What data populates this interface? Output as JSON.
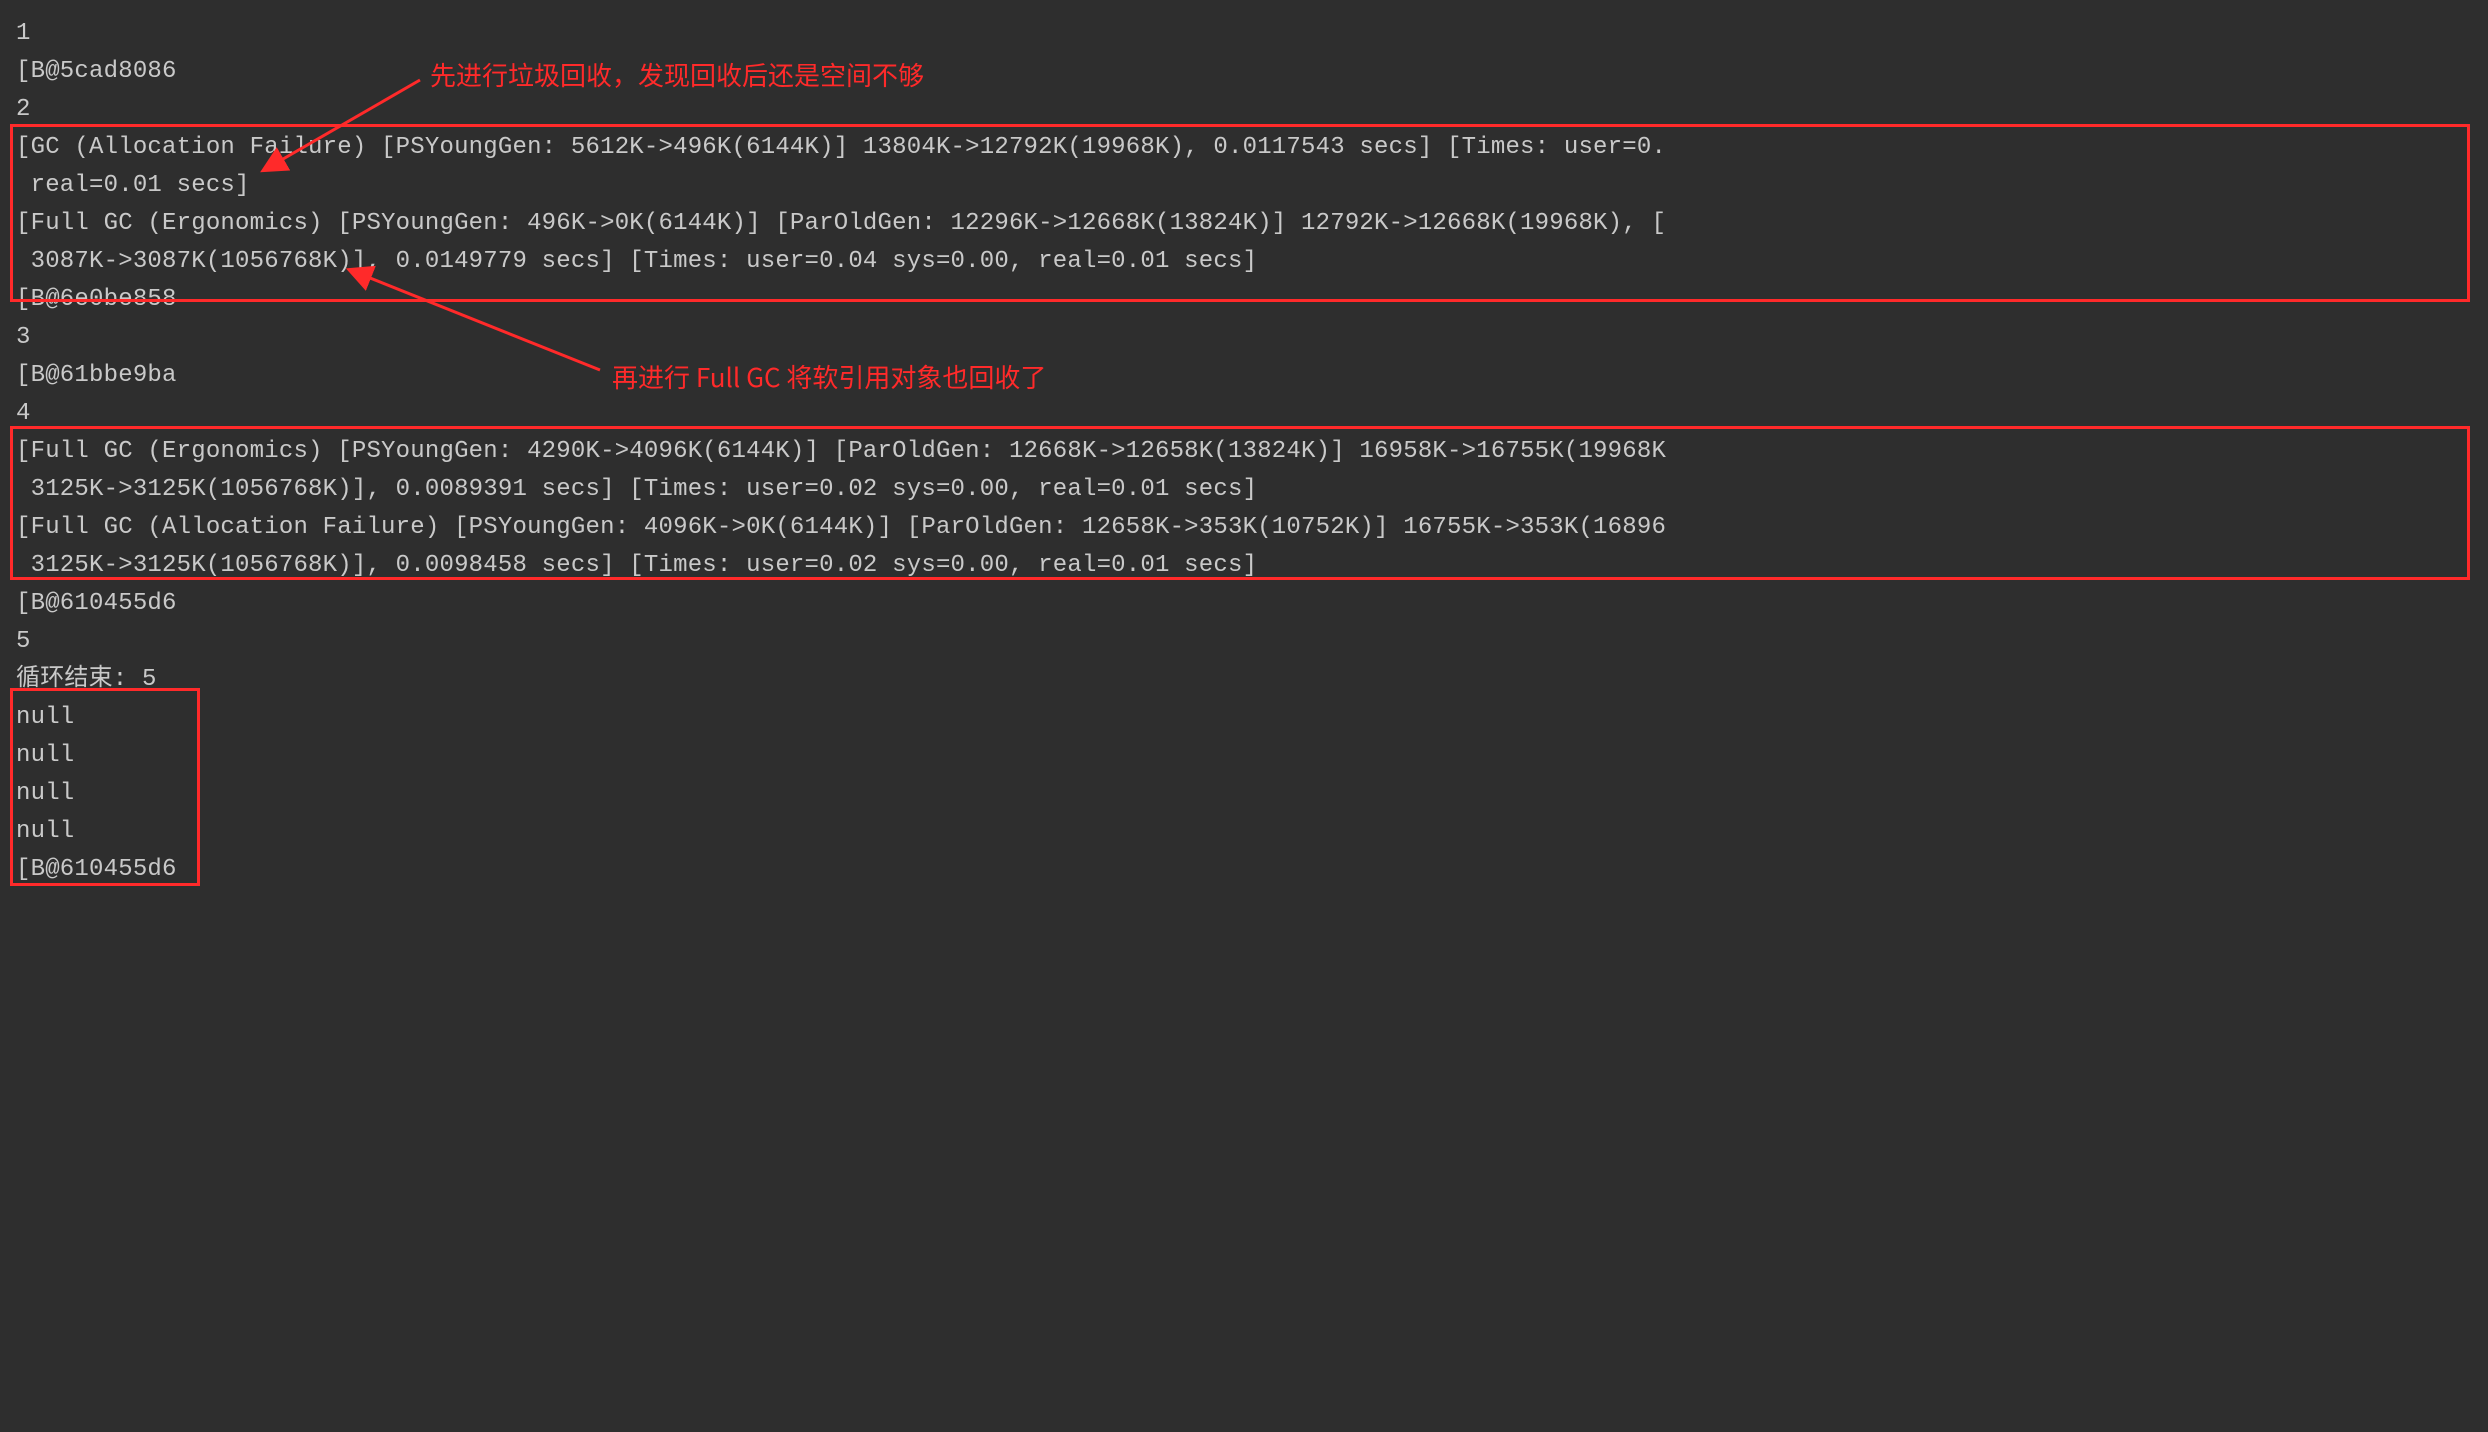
{
  "lines": {
    "l1": "1",
    "l2": "[B@5cad8086",
    "l3": "2",
    "l4": "[GC (Allocation Failure) [PSYoungGen: 5612K->496K(6144K)] 13804K->12792K(19968K), 0.0117543 secs] [Times: user=0.",
    "l5": " real=0.01 secs]",
    "l6": "[Full GC (Ergonomics) [PSYoungGen: 496K->0K(6144K)] [ParOldGen: 12296K->12668K(13824K)] 12792K->12668K(19968K), [",
    "l7": " 3087K->3087K(1056768K)], 0.0149779 secs] [Times: user=0.04 sys=0.00, real=0.01 secs]",
    "l8": "[B@6e0be858",
    "l9": "3",
    "l10": "[B@61bbe9ba",
    "l11": "4",
    "l12": "[Full GC (Ergonomics) [PSYoungGen: 4290K->4096K(6144K)] [ParOldGen: 12668K->12658K(13824K)] 16958K->16755K(19968K",
    "l13": " 3125K->3125K(1056768K)], 0.0089391 secs] [Times: user=0.02 sys=0.00, real=0.01 secs]",
    "l14": "[Full GC (Allocation Failure) [PSYoungGen: 4096K->0K(6144K)] [ParOldGen: 12658K->353K(10752K)] 16755K->353K(16896",
    "l15": " 3125K->3125K(1056768K)], 0.0098458 secs] [Times: user=0.02 sys=0.00, real=0.01 secs]",
    "l16": "[B@610455d6",
    "l17": "5",
    "l18": "循环结束: 5",
    "l19": "null",
    "l20": "null",
    "l21": "null",
    "l22": "null",
    "l23": "[B@610455d6"
  },
  "annotations": {
    "a1": "先进行垃圾回收，发现回收后还是空间不够",
    "a2": "再进行 Full GC 将软引用对象也回收了"
  }
}
